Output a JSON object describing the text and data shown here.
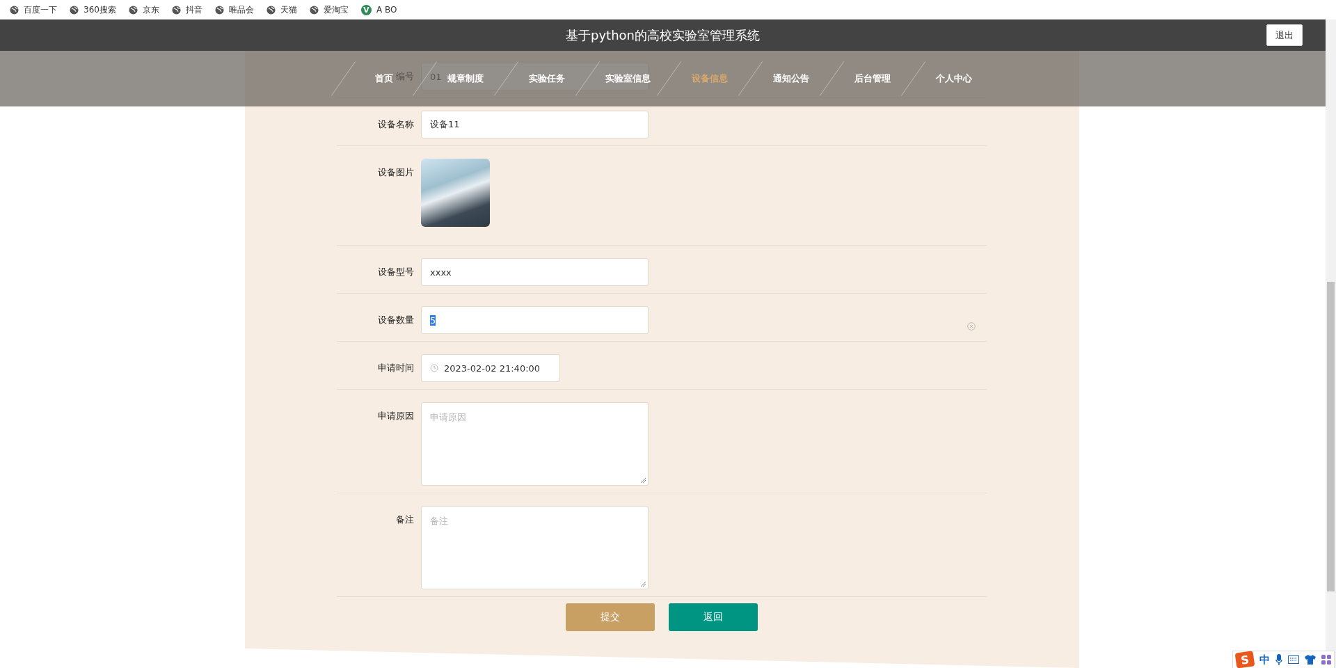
{
  "bookmarks": [
    {
      "label": "百度一下",
      "kind": "globe"
    },
    {
      "label": "360搜索",
      "kind": "globe"
    },
    {
      "label": "京东",
      "kind": "globe"
    },
    {
      "label": "抖音",
      "kind": "globe"
    },
    {
      "label": "唯品会",
      "kind": "globe"
    },
    {
      "label": "天猫",
      "kind": "globe"
    },
    {
      "label": "爱淘宝",
      "kind": "globe"
    },
    {
      "label": "A BO",
      "kind": "badge",
      "badge": "V"
    }
  ],
  "header": {
    "title": "基于python的高校实验室管理系统",
    "logout": "退出"
  },
  "nav": [
    {
      "label": "首页",
      "selected": false
    },
    {
      "label": "规章制度",
      "selected": false
    },
    {
      "label": "实验任务",
      "selected": false
    },
    {
      "label": "实验室信息",
      "selected": false
    },
    {
      "label": "设备信息",
      "selected": true
    },
    {
      "label": "通知公告",
      "selected": false
    },
    {
      "label": "后台管理",
      "selected": false
    },
    {
      "label": "个人中心",
      "selected": false
    }
  ],
  "form": {
    "fields": [
      {
        "label": "编号",
        "kind": "text",
        "value": "01",
        "highlighted": false,
        "clearable": false
      },
      {
        "label": "设备名称",
        "kind": "text",
        "value": "设备11",
        "highlighted": false,
        "clearable": false
      },
      {
        "label": "设备图片",
        "kind": "image"
      },
      {
        "label": "设备型号",
        "kind": "text",
        "value": "xxxx",
        "highlighted": false,
        "clearable": false
      },
      {
        "label": "设备数量",
        "kind": "text",
        "value": "5",
        "highlighted": true,
        "clearable": true
      },
      {
        "label": "申请时间",
        "kind": "datetime",
        "value": "2023-02-02 21:40:00"
      },
      {
        "label": "申请原因",
        "kind": "textarea",
        "placeholder": "申请原因"
      },
      {
        "label": "备注",
        "kind": "textarea",
        "placeholder": "备注"
      }
    ],
    "buttons": [
      {
        "label": "提交",
        "kind": "primary"
      },
      {
        "label": "返回",
        "kind": "secondary"
      }
    ]
  },
  "ime": {
    "logo": "S",
    "mode": "中"
  }
}
